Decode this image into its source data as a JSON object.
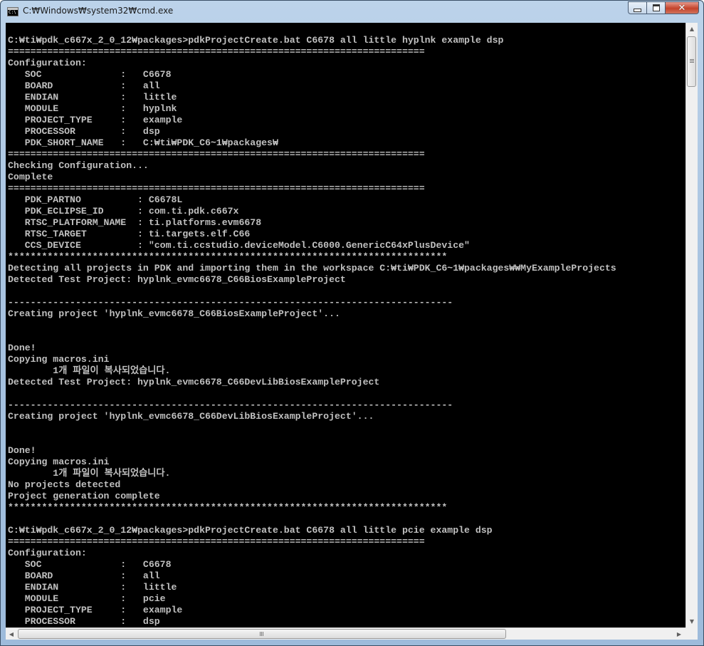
{
  "window": {
    "title": "C:₩Windows₩system32₩cmd.exe",
    "icon": "console-app-icon",
    "buttons": {
      "minimize": "minimize-icon",
      "maximize": "maximize-icon",
      "close": "close-icon"
    }
  },
  "colors": {
    "console_bg": "#000000",
    "console_fg": "#c0c0c0",
    "close_button": "#c4432b",
    "title_bar": "#a9c4e1"
  },
  "console": {
    "lines": [
      "C:₩ti₩pdk_c667x_2_0_12₩packages>pdkProjectCreate.bat C6678 all little hyplnk example dsp",
      "==========================================================================",
      "Configuration:",
      "   SOC              :   C6678",
      "   BOARD            :   all",
      "   ENDIAN           :   little",
      "   MODULE           :   hyplnk",
      "   PROJECT_TYPE     :   example",
      "   PROCESSOR        :   dsp",
      "   PDK_SHORT_NAME   :   C:₩ti₩PDK_C6~1₩packages₩",
      "==========================================================================",
      "Checking Configuration...",
      "Complete",
      "==========================================================================",
      "   PDK_PARTNO          : C6678L",
      "   PDK_ECLIPSE_ID      : com.ti.pdk.c667x",
      "   RTSC_PLATFORM_NAME  : ti.platforms.evm6678",
      "   RTSC_TARGET         : ti.targets.elf.C66",
      "   CCS_DEVICE          : \"com.ti.ccstudio.deviceModel.C6000.GenericC64xPlusDevice\"",
      "******************************************************************************",
      "Detecting all projects in PDK and importing them in the workspace C:₩ti₩PDK_C6~1₩packages₩₩MyExampleProjects",
      "Detected Test Project: hyplnk_evmc6678_C66BiosExampleProject",
      "",
      "-------------------------------------------------------------------------------",
      "Creating project 'hyplnk_evmc6678_C66BiosExampleProject'...",
      "",
      "",
      "Done!",
      "Copying macros.ini",
      "        1개 파일이 복사되었습니다.",
      "Detected Test Project: hyplnk_evmc6678_C66DevLibBiosExampleProject",
      "",
      "-------------------------------------------------------------------------------",
      "Creating project 'hyplnk_evmc6678_C66DevLibBiosExampleProject'...",
      "",
      "",
      "Done!",
      "Copying macros.ini",
      "        1개 파일이 복사되었습니다.",
      "No projects detected",
      "Project generation complete",
      "******************************************************************************",
      "",
      "C:₩ti₩pdk_c667x_2_0_12₩packages>pdkProjectCreate.bat C6678 all little pcie example dsp",
      "==========================================================================",
      "Configuration:",
      "   SOC              :   C6678",
      "   BOARD            :   all",
      "   ENDIAN           :   little",
      "   MODULE           :   pcie",
      "   PROJECT_TYPE     :   example",
      "   PROCESSOR        :   dsp"
    ]
  },
  "scrollbars": {
    "vertical": {
      "up": "scroll-up-arrow-icon",
      "down": "scroll-down-arrow-icon"
    },
    "horizontal": {
      "left": "scroll-left-arrow-icon",
      "right": "scroll-right-arrow-icon"
    }
  }
}
